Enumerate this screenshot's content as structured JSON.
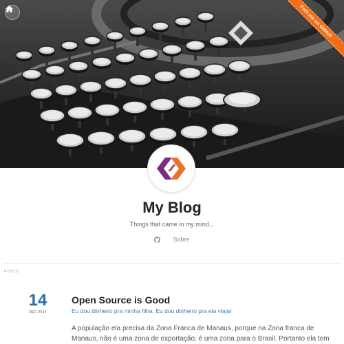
{
  "ribbon": {
    "label": "Fork me on GitHub",
    "color": "#f36f16"
  },
  "nav": {
    "home_icon": "home-icon"
  },
  "header": {
    "title": "My Blog",
    "tagline": "Things that came in my mind...",
    "links": [
      {
        "icon": "github-icon",
        "label": ""
      },
      {
        "label": "Sobre"
      }
    ]
  },
  "section": {
    "label": "POSTS"
  },
  "posts": [
    {
      "day": "14",
      "month_year": "DEC 2014",
      "title": "Open Source is Good",
      "subtitle": "Eu dou dinheiro pra minha filha. Eu dou dinheiro pra ela viajar",
      "excerpt_line1": "A população ela precisa da Zona Franca de Manaus, porque na Zona franca de",
      "excerpt_line2": "Manaus, não é uma zona de exportação, é uma zona para o Brasil. Portanto ela tem"
    }
  ],
  "colors": {
    "accent": "#2a6ead",
    "link": "#3a7dbf",
    "logo_orange": "#e8742a",
    "logo_purple": "#7b2d80"
  }
}
